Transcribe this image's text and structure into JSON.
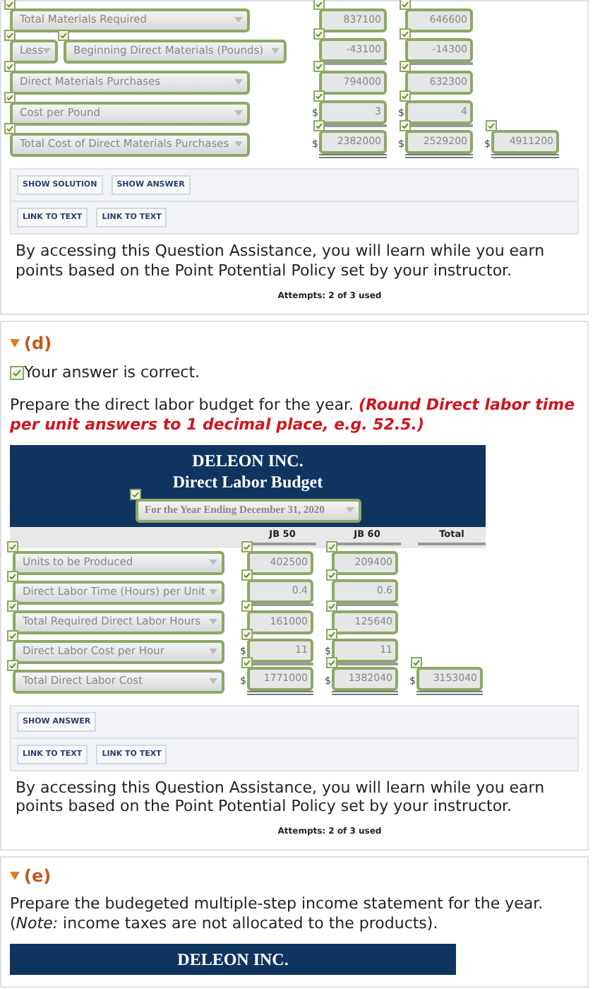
{
  "part_c": {
    "rows": [
      {
        "qualifier": null,
        "label": "Total Materials Required",
        "correct": true,
        "cells": [
          {
            "value": "837100"
          },
          {
            "value": "646600"
          },
          null
        ]
      },
      {
        "qualifier": "Less",
        "label": "Beginning Direct Materials (Pounds)",
        "correct": true,
        "cells": [
          {
            "value": "-43100"
          },
          {
            "value": "-14300"
          },
          null
        ]
      },
      {
        "qualifier": null,
        "label": "Direct Materials Purchases",
        "correct": true,
        "cells": [
          {
            "value": "794000"
          },
          {
            "value": "632300"
          },
          null
        ]
      },
      {
        "qualifier": null,
        "label": "Cost per Pound",
        "correct": true,
        "cells": [
          {
            "currency": "$",
            "value": "3"
          },
          {
            "currency": "$",
            "value": "4"
          },
          null
        ]
      },
      {
        "qualifier": null,
        "label": "Total Cost of Direct Materials Purchases",
        "correct": true,
        "cells": [
          {
            "currency": "$",
            "value": "2382000"
          },
          {
            "currency": "$",
            "value": "2529200"
          },
          {
            "currency": "$",
            "value": "4911200"
          }
        ]
      }
    ],
    "button_rows": [
      [
        "SHOW SOLUTION",
        "SHOW ANSWER"
      ],
      [
        "LINK TO TEXT",
        "LINK TO TEXT"
      ]
    ],
    "assistance_text": "By accessing this Question Assistance, you will learn while you earn points based on the Point Potential Policy set by your instructor.",
    "attempts": "Attempts: 2 of 3 used"
  },
  "part_d": {
    "label": "(d)",
    "expanded": true,
    "result": "Your answer is correct.",
    "correct": true,
    "prompt": "Prepare the direct labor budget for the year.",
    "instruction": "(Round Direct labor time per unit answers to 1 decimal place, e.g. 52.5.)",
    "budget": {
      "company": "DELEON INC.",
      "title": "Direct Labor Budget",
      "period": "For the Year Ending December 31, 2020",
      "period_correct": true,
      "columns": [
        "JB 50",
        "JB 60",
        "Total"
      ],
      "rows": [
        {
          "label": "Units to be Produced",
          "correct": true,
          "cells": [
            {
              "value": "402500"
            },
            {
              "value": "209400"
            },
            null
          ]
        },
        {
          "label": "Direct Labor Time (Hours) per Unit",
          "correct": true,
          "cells": [
            {
              "value": "0.4"
            },
            {
              "value": "0.6"
            },
            null
          ]
        },
        {
          "label": "Total Required Direct Labor Hours",
          "correct": true,
          "cells": [
            {
              "value": "161000"
            },
            {
              "value": "125640"
            },
            null
          ]
        },
        {
          "label": "Direct Labor Cost per Hour",
          "correct": true,
          "cells": [
            {
              "currency": "$",
              "value": "11"
            },
            {
              "currency": "$",
              "value": "11"
            },
            null
          ]
        },
        {
          "label": "Total Direct Labor Cost",
          "correct": true,
          "cells": [
            {
              "currency": "$",
              "value": "1771000"
            },
            {
              "currency": "$",
              "value": "1382040"
            },
            {
              "currency": "$",
              "value": "3153040"
            }
          ]
        }
      ]
    },
    "button_rows": [
      [
        "SHOW ANSWER"
      ],
      [
        "LINK TO TEXT",
        "LINK TO TEXT"
      ]
    ],
    "assistance_text": "By accessing this Question Assistance, you will learn while you earn points based on the Point Potential Policy set by your instructor.",
    "attempts": "Attempts: 2 of 3 used"
  },
  "part_e": {
    "label": "(e)",
    "expanded": true,
    "prompt": "Prepare the budegeted multiple-step income statement for the year. (*Note:* income taxes are not allocated to the products).",
    "company": "DELEON INC."
  }
}
